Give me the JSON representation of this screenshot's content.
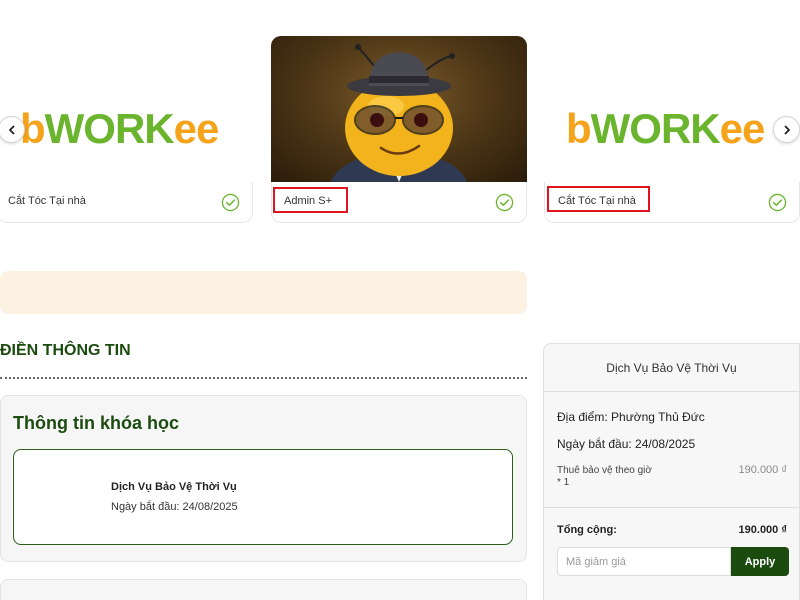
{
  "carousel": {
    "cards": [
      {
        "title": "Cắt Tóc Tại nhà",
        "logo_left": "b",
        "logo_mid": "WORK",
        "logo_right": "ee"
      },
      {
        "title": "Admin S+"
      },
      {
        "title": "Cắt Tóc Tại nhà",
        "logo_left": "b",
        "logo_mid": "WORK",
        "logo_right": "ee"
      }
    ],
    "prev_icon": "chevron-left-icon",
    "next_icon": "chevron-right-icon"
  },
  "form": {
    "section_title": "ĐIỀN THÔNG TIN",
    "info_title": "Thông tin khóa học",
    "course": {
      "name": "Dịch Vụ Bảo Vệ Thời Vụ",
      "start": "Ngày bắt đầu: 24/08/2025"
    }
  },
  "summary": {
    "header": "Dịch Vụ Bảo Vệ Thời Vụ",
    "location": "Địa điểm: Phường Thủ Đức",
    "start": "Ngày bắt đầu: 24/08/2025",
    "item_label": "Thuê bảo vệ theo giờ",
    "item_qty": "* 1",
    "item_price": "190.000 ₫",
    "total_label": "Tổng cộng:",
    "total_value": "190.000 ₫",
    "coupon_placeholder": "Mã giảm giá",
    "apply_label": "Apply"
  },
  "colors": {
    "brand_green": "#1c4b10",
    "logo_orange": "#f5a31a",
    "logo_green": "#6bb42d",
    "highlight_red": "#e0141e",
    "banner_bg": "#fdf1e4"
  }
}
